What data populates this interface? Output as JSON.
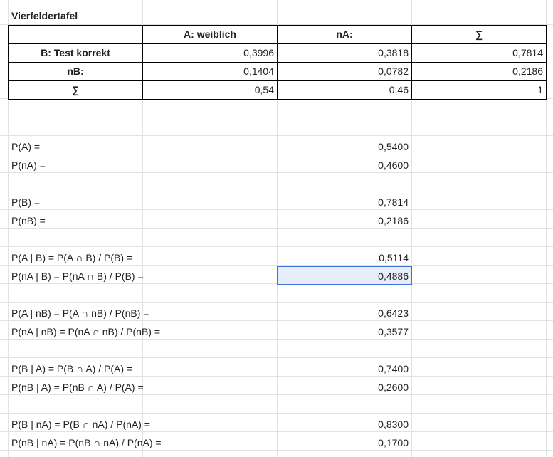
{
  "title": "Vierfeldertafel",
  "table": {
    "headers": [
      "",
      "A: weiblich",
      "nA:",
      "∑"
    ],
    "rows": [
      {
        "label": "B: Test korrekt",
        "values": [
          "0,3996",
          "0,3818",
          "0,7814"
        ]
      },
      {
        "label": "nB:",
        "values": [
          "0,1404",
          "0,0782",
          "0,2186"
        ]
      },
      {
        "label": "∑",
        "values": [
          "0,54",
          "0,46",
          "1"
        ]
      }
    ]
  },
  "calc": [
    {
      "label": "P(A) =",
      "value": "0,5400"
    },
    {
      "label": "P(nA) =",
      "value": "0,4600"
    },
    {
      "label": "P(B) =",
      "value": "0,7814"
    },
    {
      "label": "P(nB) =",
      "value": "0,2186"
    },
    {
      "label": "P(A | B) = P(A ∩ B) / P(B) =",
      "value": "0,5114"
    },
    {
      "label": "P(nA | B) = P(nA ∩ B) / P(B) =",
      "value": "0,4886"
    },
    {
      "label": "P(A | nB) = P(A ∩ nB) / P(nB) =",
      "value": "0,6423"
    },
    {
      "label": "P(nA | nB) = P(nA ∩ nB) / P(nB) =",
      "value": "0,3577"
    },
    {
      "label": "P(B | A) = P(B ∩ A) / P(A) =",
      "value": "0,7400"
    },
    {
      "label": "P(nB | A) = P(nB ∩ A) / P(A) =",
      "value": "0,2600"
    },
    {
      "label": "P(B | nA) = P(B ∩ nA) / P(nA) =",
      "value": "0,8300"
    },
    {
      "label": "P(nB | nA) = P(nB ∩ nA) / P(nA) =",
      "value": "0,1700"
    }
  ],
  "colors": {
    "selection_border": "#3b73d6",
    "selection_fill": "#e8eef9",
    "gridline": "#e2e2e2"
  }
}
